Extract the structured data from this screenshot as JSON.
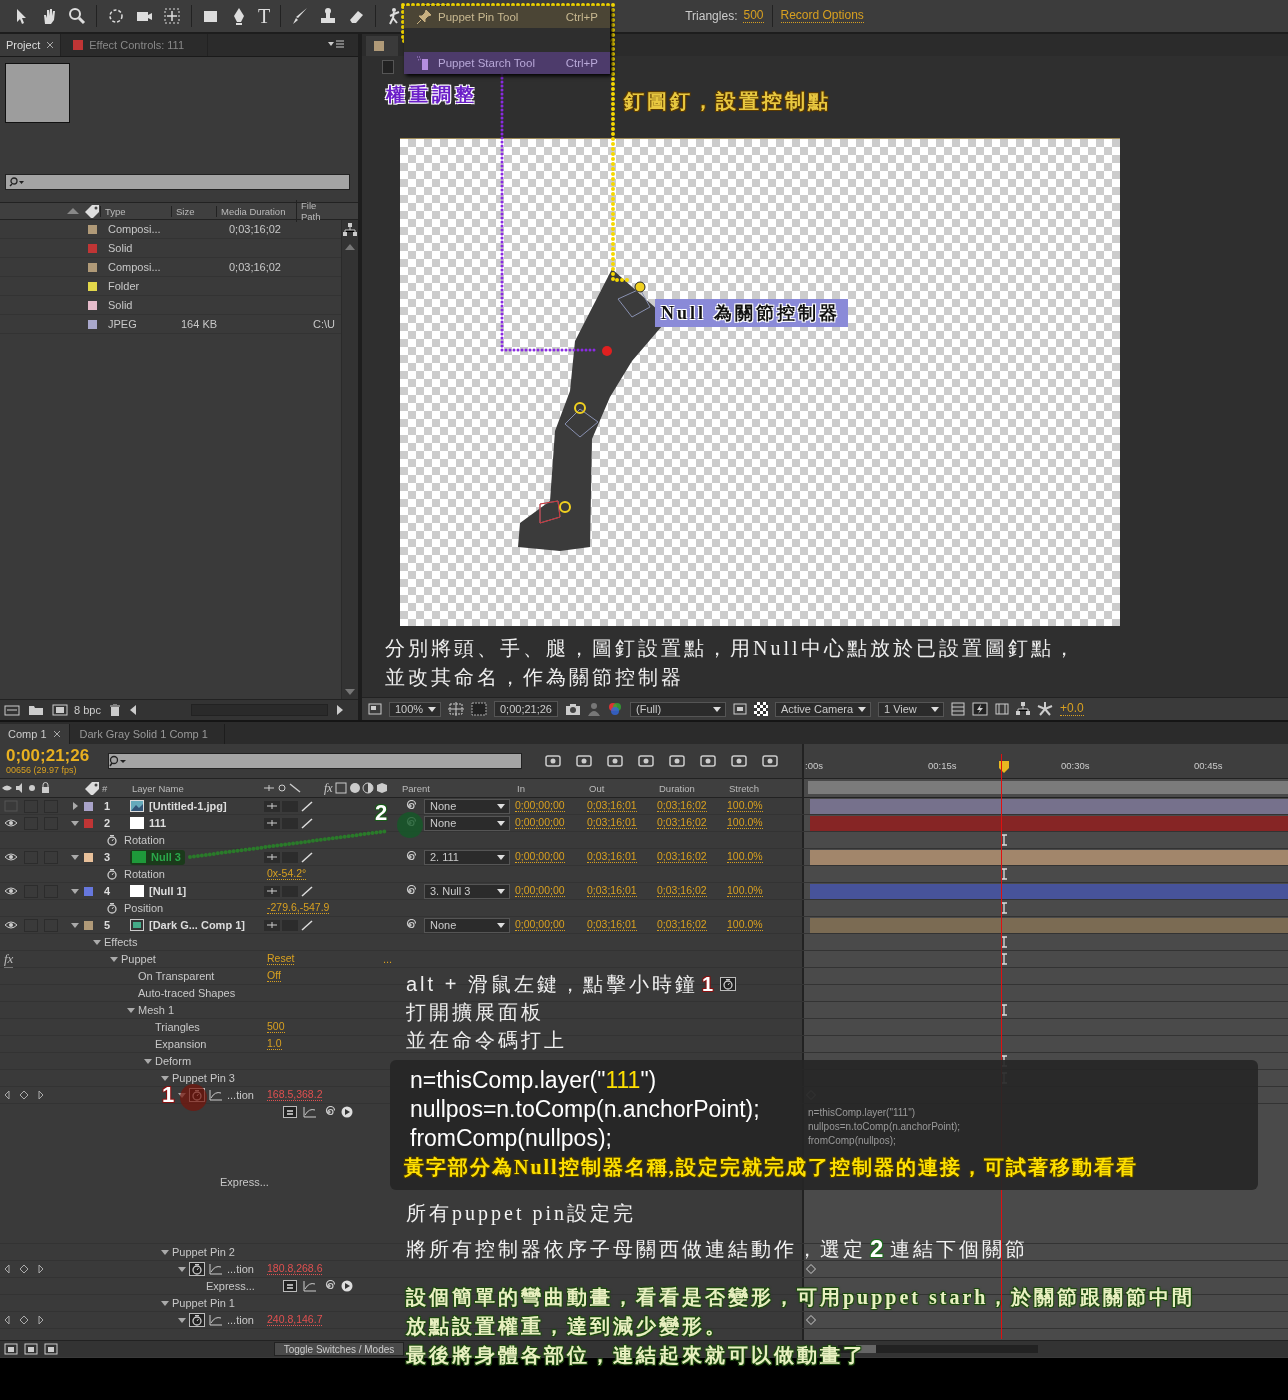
{
  "toolbar": {
    "text_tool": "T",
    "triangles_label": "Triangles:",
    "triangles_value": "500",
    "record_options": "Record Options"
  },
  "tool_menu": [
    {
      "label": "Puppet Pin Tool",
      "shortcut": "Ctrl+P",
      "color": "#4b4535"
    },
    {
      "label": "Puppet Starch Tool",
      "shortcut": "Ctrl+P",
      "color": "#4d3b6b"
    }
  ],
  "project": {
    "tabs": [
      {
        "label": "Project",
        "selected": true
      },
      {
        "label": "Effect Controls: 111",
        "selected": false,
        "color": "#c03535"
      }
    ],
    "columns": [
      "Type",
      "Size",
      "Media Duration",
      "File Path"
    ],
    "rows": [
      {
        "color": "#b09a78",
        "type": "Composi...",
        "duration": "0;03;16;02"
      },
      {
        "color": "#c03535",
        "type": "Solid"
      },
      {
        "color": "#b09a78",
        "type": "Composi...",
        "duration": "0;03;16;02"
      },
      {
        "color": "#e3d84a",
        "type": "Folder"
      },
      {
        "color": "#e6bccb",
        "type": "Solid"
      },
      {
        "color": "#a9a8cc",
        "type": "JPEG",
        "size": "164 KB",
        "path": "C:\\U"
      }
    ],
    "footer": "8 bpc"
  },
  "viewer": {
    "zoom": "100%",
    "time": "0;00;21;26",
    "resolution": "(Full)",
    "camera": "Active Camera",
    "views": "1 View",
    "exposure": "+0.0"
  },
  "timeline": {
    "tabs": [
      {
        "label": "Comp 1",
        "selected": true
      },
      {
        "label": "Dark Gray Solid 1 Comp 1",
        "selected": false
      }
    ],
    "time": "0;00;21;26",
    "frames": "00656 (29.97 fps)",
    "columns": {
      "number": "#",
      "name": "Layer Name",
      "effects": "fx",
      "parent": "Parent",
      "in": "In",
      "out": "Out",
      "duration": "Duration",
      "stretch": "Stretch"
    },
    "ruler": [
      ":00s",
      "00:15s",
      "00:30s",
      "00:45s"
    ],
    "toggle": "Toggle Switches / Modes",
    "zoom": {
      "level": 0.1
    },
    "layers": [
      {
        "number": "1",
        "name": "[Untitled-1.jpg]",
        "kind": "image",
        "color": "#a9a3c9",
        "visible": false,
        "selected": false,
        "expanded": false,
        "parent": "None",
        "in": "0;00;00;00",
        "out": "0;03;16;01",
        "duration": "0;03;16;02",
        "stretch": "100.0%"
      },
      {
        "number": "2",
        "name": "111",
        "kind": "solid",
        "color": "#c03535",
        "visible": true,
        "selected": false,
        "expanded": true,
        "parent": "None",
        "in": "0;00;00;00",
        "out": "0;03;16;01",
        "duration": "0;03;16;02",
        "stretch": "100.0%",
        "children": [
          {
            "kind": "prop",
            "label": "Rotation"
          }
        ]
      },
      {
        "number": "3",
        "name": "Null 3",
        "kind": "solid",
        "color": "#e8c09a",
        "visible": true,
        "selected": true,
        "expanded": true,
        "parent": "2. 111",
        "in": "0;00;00;00",
        "out": "0;03;16;01",
        "duration": "0;03;16;02",
        "stretch": "100.0%",
        "children": [
          {
            "kind": "prop",
            "label": "Rotation",
            "value": "0x-54.2°"
          }
        ]
      },
      {
        "number": "4",
        "name": "[Null 1]",
        "kind": "solid",
        "color": "#6677dd",
        "visible": true,
        "selected": false,
        "expanded": true,
        "parent": "3. Null 3",
        "in": "0;00;00;00",
        "out": "0;03;16;01",
        "duration": "0;03;16;02",
        "stretch": "100.0%",
        "children": [
          {
            "kind": "prop",
            "label": "Position",
            "value": "-279.6,-547.9"
          }
        ]
      },
      {
        "number": "5",
        "name": "[Dark G... Comp 1]",
        "kind": "comp",
        "color": "#b09a78",
        "visible": true,
        "selected": false,
        "expanded": true,
        "parent": "None",
        "in": "0;00;00;00",
        "out": "0;03;16;01",
        "duration": "0;03;16;02",
        "stretch": "100.0%",
        "children": [
          {
            "kind": "group",
            "label": "Effects",
            "expanded": true,
            "children": [
              {
                "kind": "effect",
                "label": "Puppet",
                "badge": "fx",
                "value": "Reset",
                "extra": "...",
                "expanded": true,
                "children": [
                  {
                    "kind": "plain",
                    "label": "On Transparent",
                    "value": "Off"
                  },
                  {
                    "kind": "plain",
                    "label": "Auto-traced Shapes"
                  },
                  {
                    "kind": "group",
                    "label": "Mesh 1",
                    "expanded": true,
                    "children": [
                      {
                        "kind": "plain",
                        "label": "Triangles",
                        "value": "500"
                      },
                      {
                        "kind": "plain",
                        "label": "Expansion",
                        "value": "1.0"
                      },
                      {
                        "kind": "group",
                        "label": "Deform",
                        "expanded": true,
                        "children": [
                          {
                            "kind": "group",
                            "label": "Puppet Pin 3",
                            "expanded": true,
                            "children": [
                              {
                                "kind": "animated",
                                "label": "...tion",
                                "value": "168.5,368.2",
                                "expanded": true,
                                "children": [
                                  {
                                    "kind": "expression",
                                    "label": "Express...",
                                    "code": [
                                      "n=thisComp.layer(\"111\")",
                                      "nullpos=n.toComp(n.anchorPoint);",
                                      "fromComp(nullpos);"
                                    ]
                                  }
                                ]
                              }
                            ]
                          },
                          {
                            "kind": "group",
                            "label": "Puppet Pin 2",
                            "expanded": true,
                            "children": [
                              {
                                "kind": "animated",
                                "label": "...tion",
                                "value": "180.8,268.6",
                                "expanded": true,
                                "children": [
                                  {
                                    "kind": "expression",
                                    "label": "Express..."
                                  }
                                ]
                              }
                            ]
                          },
                          {
                            "kind": "group",
                            "label": "Puppet Pin 1",
                            "expanded": true,
                            "children": [
                              {
                                "kind": "animated",
                                "label": "...tion",
                                "value": "240.8,146.7",
                                "expanded": true
                              }
                            ]
                          }
                        ]
                      }
                    ]
                  }
                ]
              }
            ]
          }
        ]
      }
    ]
  },
  "annotations": {
    "weight": "權重調整",
    "pin": "釘圖釘，設置控制點",
    "null_label": "Null 為關節控制器",
    "caption": [
      "分別將頭、手、腿，圖釘設置點，用Null中心點放於已設置圖釘點，",
      "並改其命名，作為關節控制器"
    ],
    "steps": [
      {
        "text": "alt + 滑鼠左鍵，點擊小時鐘",
        "badge": "1"
      },
      {
        "text": "打開擴展面板"
      },
      {
        "text": "並在命令碼打上"
      }
    ],
    "code": {
      "lines": [
        {
          "text": "n=thisComp.layer(\"",
          "highlight": "111",
          "after": "\")"
        },
        {
          "text": "nullpos=n.toComp(n.anchorPoint);"
        },
        {
          "text": "fromComp(nullpos);"
        }
      ],
      "note": "黃字部分為Null控制器名稱,設定完就完成了控制器的連接，可試著移動看看"
    },
    "notes": [
      {
        "text": "所有puppet pin設定完"
      },
      {
        "text": "將所有控制器依序子母關西做連結動作，選定",
        "badge": "2",
        "after": "連結下個關節"
      }
    ],
    "green": [
      "設個簡單的彎曲動畫，看看是否變形，可用puppet starh，於關節跟關節中間",
      "放點設置權重，達到減少變形。",
      "最後將身體各部位，連結起來就可以做動畫了"
    ],
    "markers": [
      "1",
      "2"
    ]
  }
}
